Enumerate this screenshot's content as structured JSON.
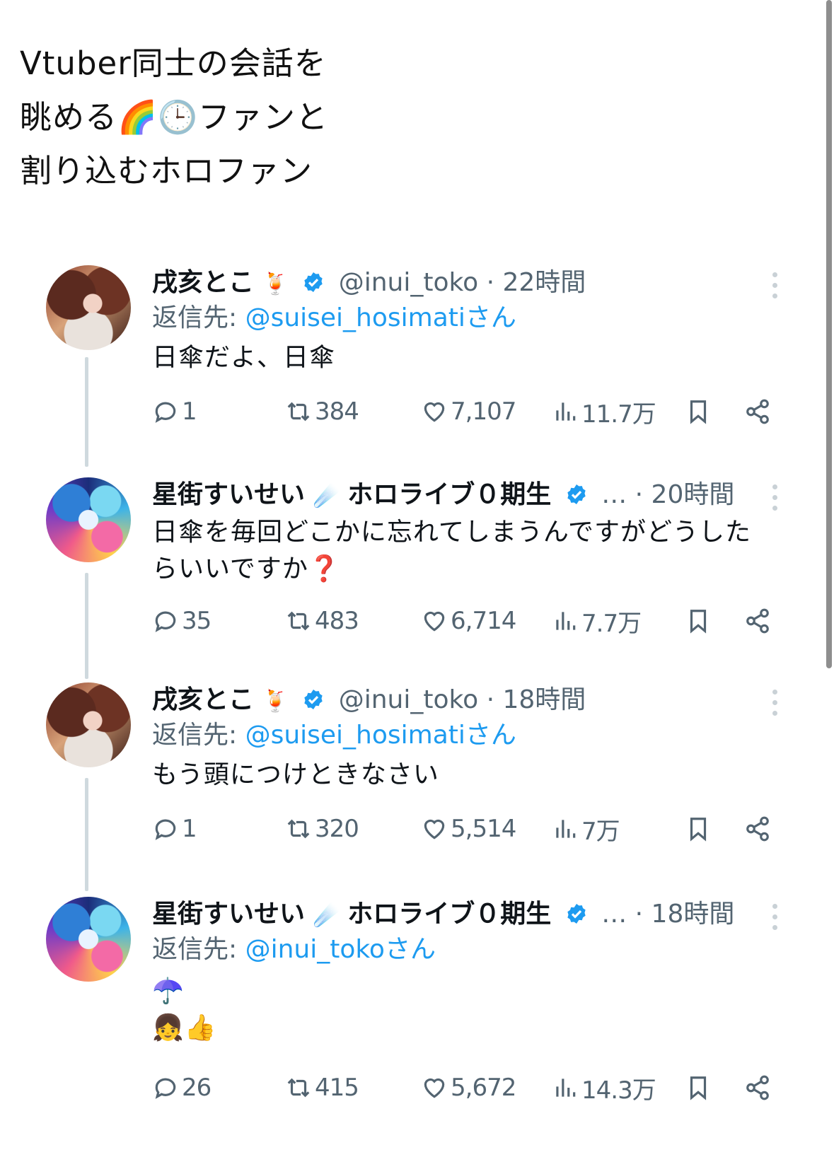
{
  "caption": {
    "line1": "Vtuber同士の会話を",
    "line2": "眺める🌈🕒ファンと",
    "line3": "割り込むホロファン"
  },
  "tweets": [
    {
      "name": "戌亥とこ",
      "name_emoji": "🍹",
      "handle": "@inui_toko",
      "time": "· 22時間",
      "reply_prefix": "返信先: ",
      "reply_handle": "@suisei_hosimati",
      "reply_suffix": "さん",
      "lines": [
        "日傘だよ、日傘"
      ],
      "replies": "1",
      "retweets": "384",
      "likes": "7,107",
      "views": "11.7万"
    },
    {
      "name": "星街すいせい",
      "name_emoji": "☄️",
      "name_rest": "ホロライブ０期生",
      "ellipsis": "…",
      "time": "· 20時間",
      "lines": [
        "日傘を毎回どこかに忘れてしまうんですがどうした",
        "らいいですか❓"
      ],
      "replies": "35",
      "retweets": "483",
      "likes": "6,714",
      "views": "7.7万"
    },
    {
      "name": "戌亥とこ",
      "name_emoji": "🍹",
      "handle": "@inui_toko",
      "time": "· 18時間",
      "reply_prefix": "返信先: ",
      "reply_handle": "@suisei_hosimati",
      "reply_suffix": "さん",
      "lines": [
        "もう頭につけときなさい"
      ],
      "replies": "1",
      "retweets": "320",
      "likes": "5,514",
      "views": "7万"
    },
    {
      "name": "星街すいせい",
      "name_emoji": "☄️",
      "name_rest": "ホロライブ０期生",
      "ellipsis": "…",
      "time": "· 18時間",
      "reply_prefix": "返信先: ",
      "reply_handle": "@inui_toko",
      "reply_suffix": "さん",
      "lines": [
        "☂️",
        "👧👍"
      ],
      "replies": "26",
      "retweets": "415",
      "likes": "5,672",
      "views": "14.3万"
    }
  ],
  "icons": [
    "reply-icon",
    "retweet-icon",
    "like-icon",
    "views-icon",
    "bookmark-icon",
    "share-icon",
    "verified-icon",
    "more-icon"
  ],
  "colors": {
    "link": "#1d9bf0",
    "muted": "#536471",
    "verified": "#1d9bf0"
  }
}
